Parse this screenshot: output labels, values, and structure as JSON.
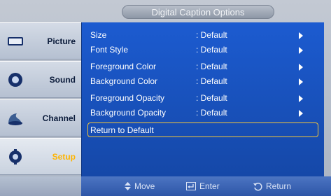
{
  "title": "Digital Caption Options",
  "sidebar": {
    "items": [
      {
        "label": "Picture",
        "icon": "picture-icon",
        "active": false
      },
      {
        "label": "Sound",
        "icon": "sound-icon",
        "active": false
      },
      {
        "label": "Channel",
        "icon": "channel-icon",
        "active": false
      },
      {
        "label": "Setup",
        "icon": "setup-icon",
        "active": true
      }
    ]
  },
  "menu": {
    "rows": [
      {
        "name": "Size",
        "value": ": Default"
      },
      {
        "name": "Font Style",
        "value": ": Default"
      },
      {
        "name": "Foreground Color",
        "value": ": Default"
      },
      {
        "name": "Background Color",
        "value": ": Default"
      },
      {
        "name": "Foreground Opacity",
        "value": ": Default"
      },
      {
        "name": "Background Opacity",
        "value": ": Default"
      }
    ],
    "reset_label": "Return to Default"
  },
  "footer": {
    "move": "Move",
    "enter": "Enter",
    "return": "Return"
  },
  "colors": {
    "panel": "#1c5bd0",
    "selection": "#f1c43a",
    "active_label": "#ffb400"
  }
}
